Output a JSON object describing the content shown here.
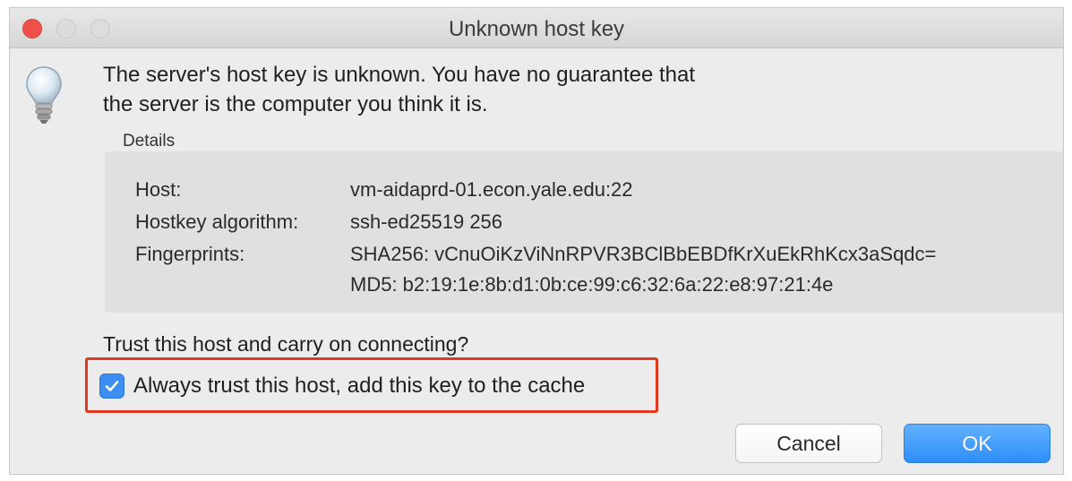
{
  "window": {
    "title": "Unknown host key"
  },
  "message": {
    "line1": "The server's host key is unknown. You have no guarantee that",
    "line2": "the server is the computer you think it is."
  },
  "details": {
    "label": "Details",
    "rows": [
      {
        "key": "Host:",
        "value": "vm-aidaprd-01.econ.yale.edu:22"
      },
      {
        "key": "Hostkey algorithm:",
        "value": "ssh-ed25519 256"
      },
      {
        "key": "Fingerprints:",
        "value": "SHA256: vCnuOiKzViNnRPVR3BClBbEBDfKrXuEkRhKcx3aSqdc="
      },
      {
        "key": "",
        "value": "MD5: b2:19:1e:8b:d1:0b:ce:99:c6:32:6a:22:e8:97:21:4e"
      }
    ]
  },
  "prompt": {
    "question": "Trust this host and carry on connecting?",
    "checkbox_label": "Always trust this host, add this key to the cache",
    "checkbox_checked": true
  },
  "buttons": {
    "cancel": "Cancel",
    "ok": "OK"
  },
  "colors": {
    "highlight": "#e0391f",
    "accent": "#3d8ef2",
    "close_button": "#f0504a"
  },
  "icons": {
    "info": "lightbulb-icon",
    "check": "checkmark-icon"
  }
}
